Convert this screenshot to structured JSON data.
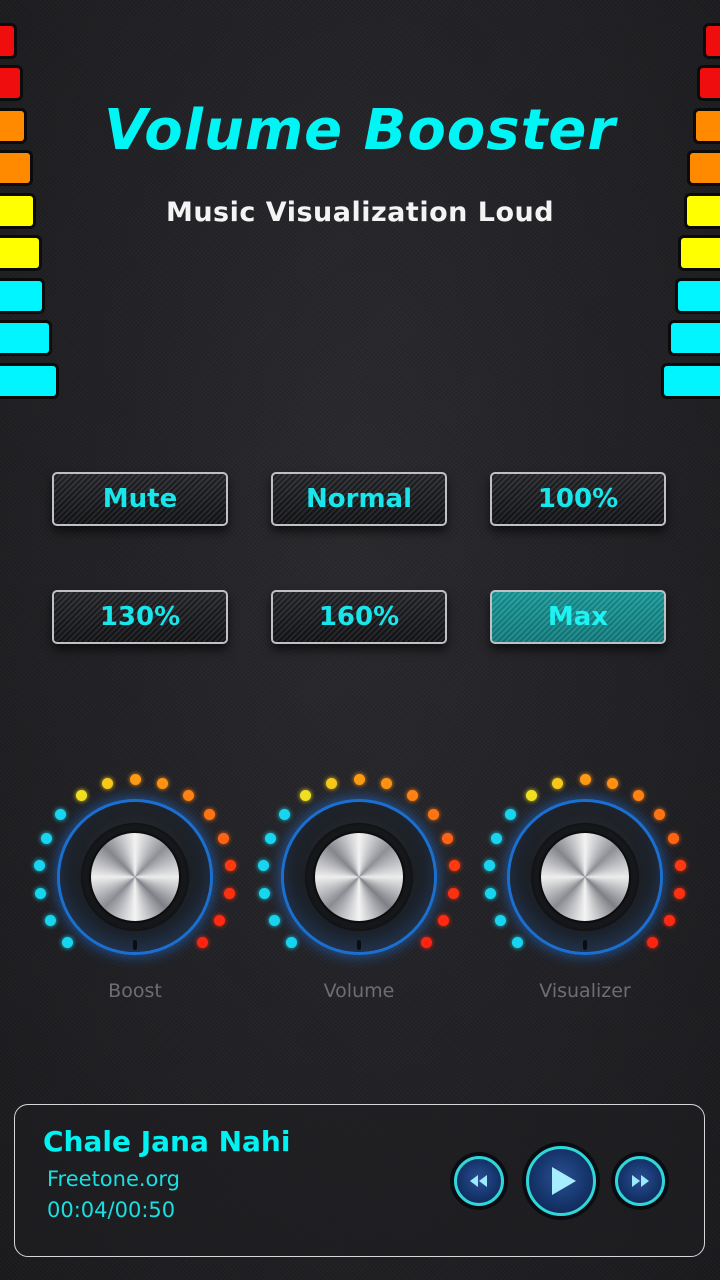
{
  "header": {
    "title": "Volume Booster",
    "subtitle": "Music Visualization Loud"
  },
  "equalizer": {
    "colors": [
      "#f00d0d",
      "#f00d0d",
      "#ff8a00",
      "#ff8a00",
      "#ffff00",
      "#ffff00",
      "#00f5ff",
      "#00f5ff",
      "#00f5ff"
    ]
  },
  "presets": [
    {
      "label": "Mute",
      "active": false
    },
    {
      "label": "Normal",
      "active": false
    },
    {
      "label": "100%",
      "active": false
    },
    {
      "label": "130%",
      "active": false
    },
    {
      "label": "160%",
      "active": false
    },
    {
      "label": "Max",
      "active": true
    }
  ],
  "knobs": [
    {
      "label": "Boost"
    },
    {
      "label": "Volume"
    },
    {
      "label": "Visualizer"
    }
  ],
  "knob_dot_colors": [
    "#18d6f0",
    "#18d6f0",
    "#18d6f0",
    "#18d6f0",
    "#18d6f0",
    "#18d6f0",
    "#f0e020",
    "#f8c818",
    "#ff9a14",
    "#ff9214",
    "#ff8214",
    "#ff7414",
    "#ff6414",
    "#ff3a10",
    "#ff3010",
    "#ff2a10",
    "#ff2410"
  ],
  "player": {
    "title": "Chale Jana Nahi",
    "artist": "Freetone.org",
    "time": "00:04/00:50",
    "controls": {
      "rewind": "rewind-icon",
      "play": "play-icon",
      "forward": "fast-forward-icon"
    }
  },
  "accent_color": "#00f3f3"
}
